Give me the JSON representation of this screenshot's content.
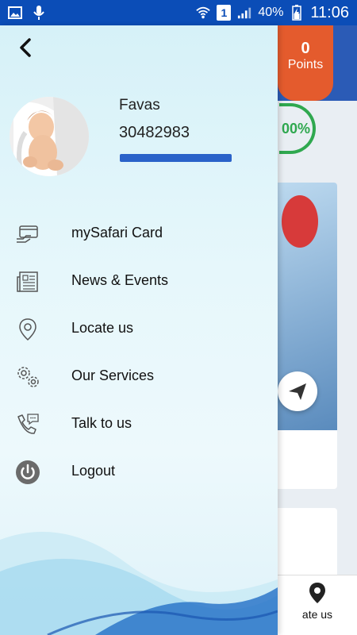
{
  "status_bar": {
    "battery": "40%",
    "time": "11:06",
    "sim": "1",
    "icons": [
      "gallery-icon",
      "microphone-icon",
      "wifi-icon",
      "sim-icon",
      "signal-icon",
      "battery-icon"
    ]
  },
  "drawer": {
    "back_icon": "chevron-left-icon",
    "profile": {
      "name": "Favas",
      "id": "30482983",
      "progress_fraction": 1.0
    },
    "menu": [
      {
        "label": "mySafari Card",
        "icon": "card-icon"
      },
      {
        "label": "News & Events",
        "icon": "newspaper-icon"
      },
      {
        "label": "Locate us",
        "icon": "location-pin-icon"
      },
      {
        "label": "Our Services",
        "icon": "gears-icon"
      },
      {
        "label": "Talk to us",
        "icon": "phone-chat-icon"
      },
      {
        "label": "Logout",
        "icon": "power-icon"
      }
    ]
  },
  "background_app": {
    "points_value": "0",
    "points_label": "Points",
    "progress_text": "00%",
    "bottom_nav_label": "ate us"
  },
  "colors": {
    "status_bar": "#0b4db7",
    "profile_bar": "#2a62c9",
    "points_badge": "#e45b2d",
    "progress_green": "#2fa84f"
  }
}
